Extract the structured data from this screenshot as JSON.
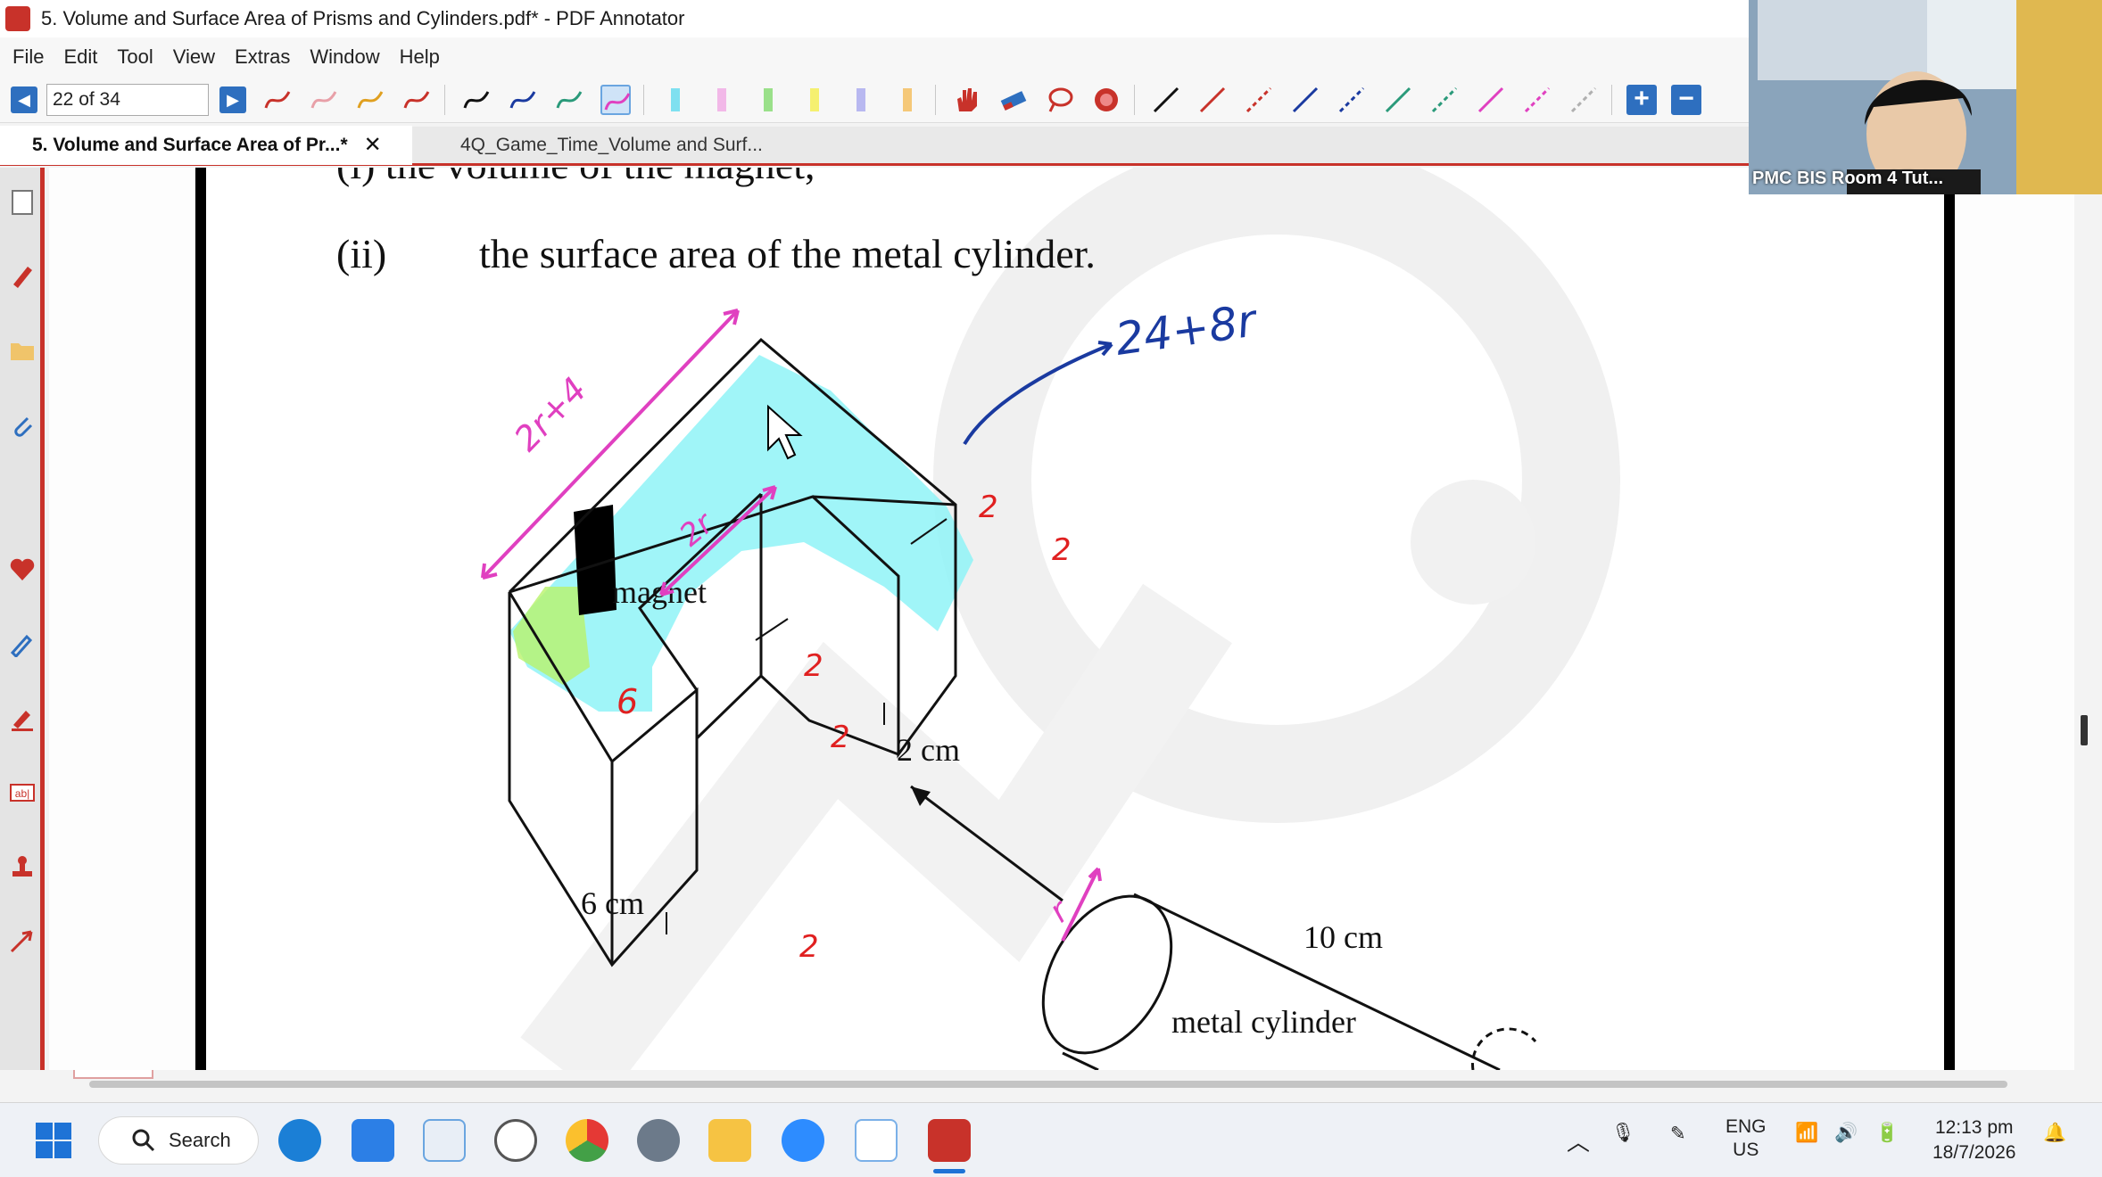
{
  "window": {
    "title": "5. Volume and Surface Area of Prisms and Cylinders.pdf* - PDF Annotator"
  },
  "menu": {
    "items": [
      "File",
      "Edit",
      "Tool",
      "View",
      "Extras",
      "Window",
      "Help"
    ]
  },
  "toolbar": {
    "page_indicator": "22 of 34",
    "prev_icon": "triangle-left-icon",
    "next_icon": "triangle-right-icon",
    "zoom_in_label": "+",
    "zoom_out_label": "−",
    "pen_colors": [
      "#c8322a",
      "#e8a0a8",
      "#e0a020",
      "#c8322a",
      "#111111",
      "#1a3aa0",
      "#2a9a7a",
      "#e040c0"
    ],
    "highlighter_colors": [
      "#7fe0f0",
      "#f2b8e8",
      "#9ae08a",
      "#f5f070",
      "#b8b8f0",
      "#f5c878"
    ],
    "line_colors": [
      "#111111",
      "#c8322a",
      "#c8322a",
      "#1a3aa0",
      "#1a3aa0",
      "#2a9a7a",
      "#2a9a7a",
      "#e040c0",
      "#e040c0",
      "#b0b0b0"
    ]
  },
  "tabs": [
    {
      "label": "5. Volume and Surface Area of Pr...*",
      "active": true,
      "close": "✕"
    },
    {
      "label": "4Q_Game_Time_Volume and Surf...",
      "active": false
    }
  ],
  "document": {
    "question_prev": "(i)   the volume of the magnet,",
    "question_label": "(ii)",
    "question_text": "the surface area of the metal cylinder.",
    "magnet_label": "magnet",
    "dim_2cm": "2 cm",
    "dim_6cm": "6 cm",
    "dim_10cm": "10 cm",
    "cylinder_label": "metal cylinder",
    "annotations": {
      "top_edge": "2r+4",
      "inner_edge": "2r",
      "arrow_note": "24+8r",
      "two": "2",
      "six": "6",
      "radius": "r"
    }
  },
  "webcam": {
    "label": "PMC BIS Room 4 Tut..."
  },
  "taskbar": {
    "search_label": "Search",
    "lang_top": "ENG",
    "lang_bottom": "US",
    "time": "12:13 pm",
    "date": "18/7/2026"
  },
  "colors": {
    "accent": "#c8322a",
    "annotation_magenta": "#e040c0",
    "annotation_blue": "#1a3aa0",
    "annotation_red": "#e02020",
    "highlight_cyan": "#8ff3f7"
  }
}
